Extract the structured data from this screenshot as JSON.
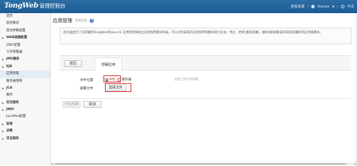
{
  "header": {
    "brand": "TongWeb",
    "title": "管理控制台",
    "links": [
      "查看资源",
      "thanos",
      "中文"
    ]
  },
  "sidebar": {
    "items": [
      {
        "label": "首页",
        "type": "item"
      },
      {
        "label": "监控概览",
        "type": "item"
      },
      {
        "label": "启动参数配置",
        "type": "item"
      },
      {
        "label": "WEB容器配置",
        "type": "group"
      },
      {
        "label": "JDBC配置",
        "type": "item"
      },
      {
        "label": "工作管理器",
        "type": "item"
      },
      {
        "label": "JMS服务",
        "type": "group"
      },
      {
        "label": "EJB",
        "type": "group"
      },
      {
        "label": "应用管理",
        "type": "item",
        "active": true
      },
      {
        "label": "服务器策略",
        "type": "item"
      },
      {
        "label": "JCA",
        "type": "group"
      },
      {
        "label": "服务",
        "type": "item"
      },
      {
        "label": "安全服务",
        "type": "group"
      },
      {
        "label": "JNDI",
        "type": "group"
      },
      {
        "label": "JavaMail配置",
        "type": "item"
      },
      {
        "label": "监视",
        "type": "group"
      },
      {
        "label": "诊断",
        "type": "group"
      },
      {
        "label": "日志服务",
        "type": "group"
      }
    ]
  },
  "main": {
    "title": "应用管理",
    "breadcrumb": "管理应用",
    "description": "此页面显示了已部署到TongWeb的Java EE 应用程序和独立应用程序模块列表，可以对所安装的应用程序和模块进行启动、停止、更新(重新部署)、删除(解部署)操作或者部署新的应用或模块。",
    "return_label": "返回",
    "tab_label": "部署应用",
    "location_label": "文件位置",
    "location_options": [
      "本机",
      "服务器"
    ],
    "file_label": "部署文件",
    "choose_file_label": "选择文件",
    "hint": "选择上传文件部署",
    "start_label": "开始部署",
    "cancel_label": "取消"
  },
  "colors": {
    "header_bg": "#1c5a93",
    "highlight": "#e03030",
    "radio_checked": "#1f62b5"
  }
}
